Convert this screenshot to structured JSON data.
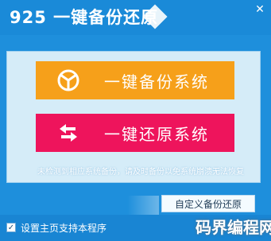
{
  "window": {
    "title": "925 一键备份还原",
    "close_glyph": "✕"
  },
  "main": {
    "backup_button": {
      "label": "一键备份系统",
      "icon": "pie-chart-icon",
      "color": "#f6a01a"
    },
    "restore_button": {
      "label": "一键还原系统",
      "icon": "swap-arrows-icon",
      "color": "#ee145c"
    },
    "notice": "未检测到相应系统备份，请及时备份以免系统崩溃无法恢复"
  },
  "custom_backup_tab": {
    "label": "自定义备份还原"
  },
  "footer": {
    "checkbox_checked": true,
    "checkbox_label": "设置主页支持本程序",
    "watermark": "码界编程网"
  },
  "colors": {
    "background": "#1e8fdc",
    "panel": "#d5ecf8"
  }
}
